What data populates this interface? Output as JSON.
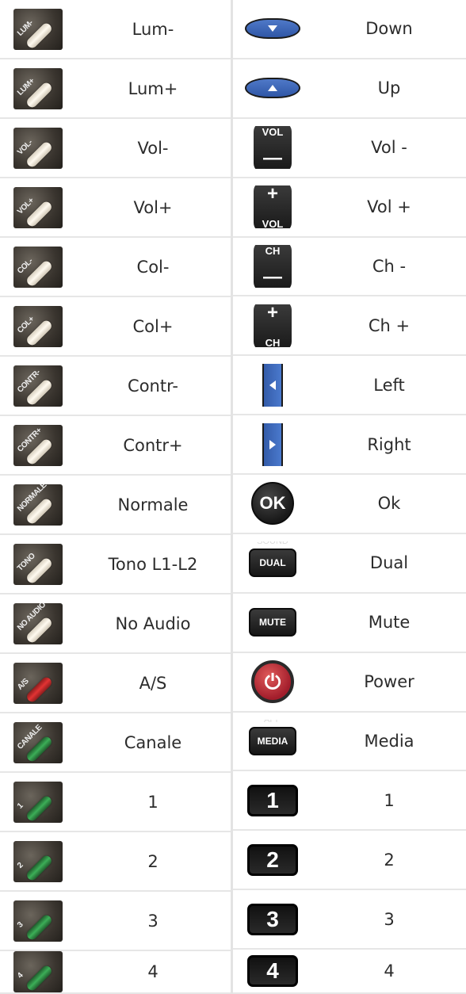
{
  "left": {
    "rows": [
      {
        "tag": "LUM-",
        "label": "Lum-",
        "icon": "lum-minus-icon",
        "keyColor": "cream"
      },
      {
        "tag": "LUM+",
        "label": "Lum+",
        "icon": "lum-plus-icon",
        "keyColor": "cream"
      },
      {
        "tag": "VOL-",
        "label": "Vol-",
        "icon": "vol-minus-icon",
        "keyColor": "cream"
      },
      {
        "tag": "VOL+",
        "label": "Vol+",
        "icon": "vol-plus-icon",
        "keyColor": "cream"
      },
      {
        "tag": "COL-",
        "label": "Col-",
        "icon": "col-minus-icon",
        "keyColor": "cream"
      },
      {
        "tag": "COL+",
        "label": "Col+",
        "icon": "col-plus-icon",
        "keyColor": "cream"
      },
      {
        "tag": "CONTR-",
        "label": "Contr-",
        "icon": "contr-minus-icon",
        "keyColor": "cream"
      },
      {
        "tag": "CONTR+",
        "label": "Contr+",
        "icon": "contr-plus-icon",
        "keyColor": "cream"
      },
      {
        "tag": "NORMALE",
        "label": "Normale",
        "icon": "normale-icon",
        "keyColor": "cream"
      },
      {
        "tag": "TONO",
        "label": "Tono L1-L2",
        "icon": "tono-icon",
        "keyColor": "cream"
      },
      {
        "tag": "NO AUDIO",
        "label": "No Audio",
        "icon": "no-audio-icon",
        "keyColor": "cream"
      },
      {
        "tag": "A/S",
        "label": "A/S",
        "icon": "a-s-icon",
        "keyColor": "red"
      },
      {
        "tag": "CANALE",
        "label": "Canale",
        "icon": "canale-icon",
        "keyColor": "green"
      },
      {
        "tag": "1",
        "label": "1",
        "icon": "number-1-icon",
        "keyColor": "green"
      },
      {
        "tag": "2",
        "label": "2",
        "icon": "number-2-icon",
        "keyColor": "green"
      },
      {
        "tag": "3",
        "label": "3",
        "icon": "number-3-icon",
        "keyColor": "green"
      },
      {
        "tag": "4",
        "label": "4",
        "icon": "number-4-icon",
        "keyColor": "green"
      }
    ]
  },
  "right": {
    "rows": [
      {
        "label": "Down",
        "icon": "down-arrow-icon",
        "keyType": "blue-arrow",
        "glyph": "down"
      },
      {
        "label": "Up",
        "icon": "up-arrow-icon",
        "keyType": "blue-arrow",
        "glyph": "up"
      },
      {
        "label": "Vol -",
        "icon": "vol-minus-button-icon",
        "keyType": "vol",
        "top": "VOL",
        "bottom": "—"
      },
      {
        "label": "Vol +",
        "icon": "vol-plus-button-icon",
        "keyType": "vol-plus",
        "top": "VOL",
        "bottom": "+"
      },
      {
        "label": "Ch -",
        "icon": "ch-minus-button-icon",
        "keyType": "vol",
        "top": "CH",
        "bottom": "—"
      },
      {
        "label": "Ch +",
        "icon": "ch-plus-button-icon",
        "keyType": "vol-plus",
        "top": "CH",
        "bottom": "+"
      },
      {
        "label": "Left",
        "icon": "left-arrow-icon",
        "keyType": "side",
        "glyph": "left"
      },
      {
        "label": "Right",
        "icon": "right-arrow-icon",
        "keyType": "side",
        "glyph": "right"
      },
      {
        "label": "Ok",
        "icon": "ok-button-icon",
        "keyType": "round",
        "text": "OK"
      },
      {
        "label": "Dual",
        "icon": "dual-button-icon",
        "keyType": "rect",
        "text": "DUAL",
        "small": "SOUND"
      },
      {
        "label": "Mute",
        "icon": "mute-button-icon",
        "keyType": "rect",
        "text": "MUTE",
        "small": ""
      },
      {
        "label": "Power",
        "icon": "power-icon",
        "keyType": "power",
        "text": "⏻"
      },
      {
        "label": "Media",
        "icon": "media-button-icon",
        "keyType": "rect",
        "text": "MEDIA",
        "small": "APP"
      },
      {
        "label": "1",
        "icon": "key-1-icon",
        "keyType": "num",
        "text": "1"
      },
      {
        "label": "2",
        "icon": "key-2-icon",
        "keyType": "num",
        "text": "2"
      },
      {
        "label": "3",
        "icon": "key-3-icon",
        "keyType": "num",
        "text": "3"
      },
      {
        "label": "4",
        "icon": "key-4-icon",
        "keyType": "num",
        "text": "4"
      }
    ]
  }
}
